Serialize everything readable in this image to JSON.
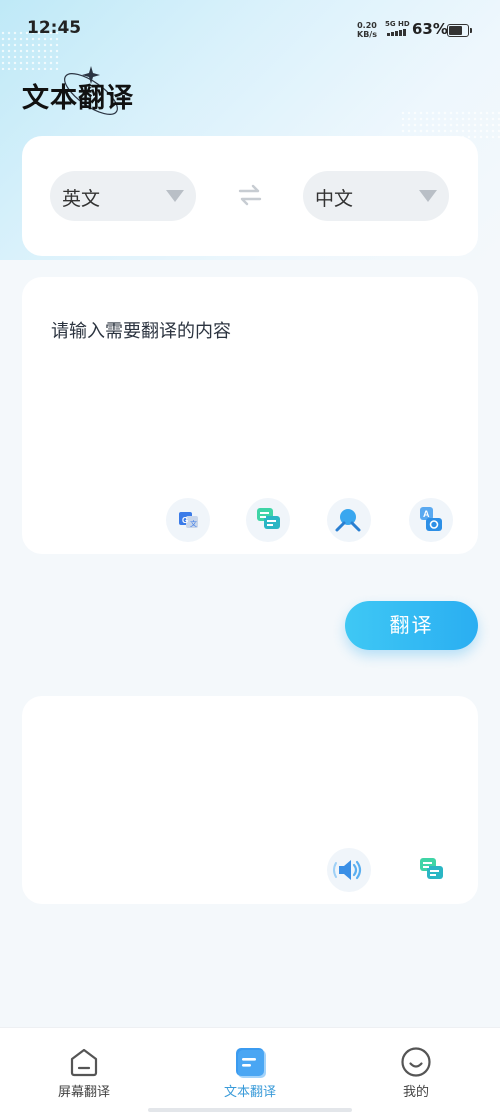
{
  "status_bar": {
    "time": "12:45",
    "net_speed_value": "0.20",
    "net_speed_unit": "KB/s",
    "signal_label": "5G HD",
    "battery_percent": "63%",
    "battery_level": 0.63
  },
  "header": {
    "title": "文本翻译"
  },
  "language_selector": {
    "source_language": "英文",
    "target_language": "中文"
  },
  "input": {
    "placeholder": "请输入需要翻译的内容",
    "tools": [
      {
        "icon": "google-translate-icon"
      },
      {
        "icon": "chat-bubbles-icon"
      },
      {
        "icon": "search-clear-icon"
      },
      {
        "icon": "image-text-recognize-icon"
      }
    ]
  },
  "actions": {
    "translate_label": "翻译"
  },
  "output": {
    "tools": [
      {
        "icon": "speaker-icon"
      },
      {
        "icon": "chat-bubbles-icon"
      }
    ]
  },
  "bottom_nav": {
    "items": [
      {
        "label": "屏幕翻译",
        "icon": "home-icon",
        "active": false
      },
      {
        "label": "文本翻译",
        "icon": "document-icon",
        "active": true
      },
      {
        "label": "我的",
        "icon": "smile-icon",
        "active": false
      }
    ]
  },
  "colors": {
    "accent": "#2aaef2",
    "active_nav": "#3a9bd9",
    "card_background": "#ffffff",
    "select_background": "#edf0f3"
  }
}
